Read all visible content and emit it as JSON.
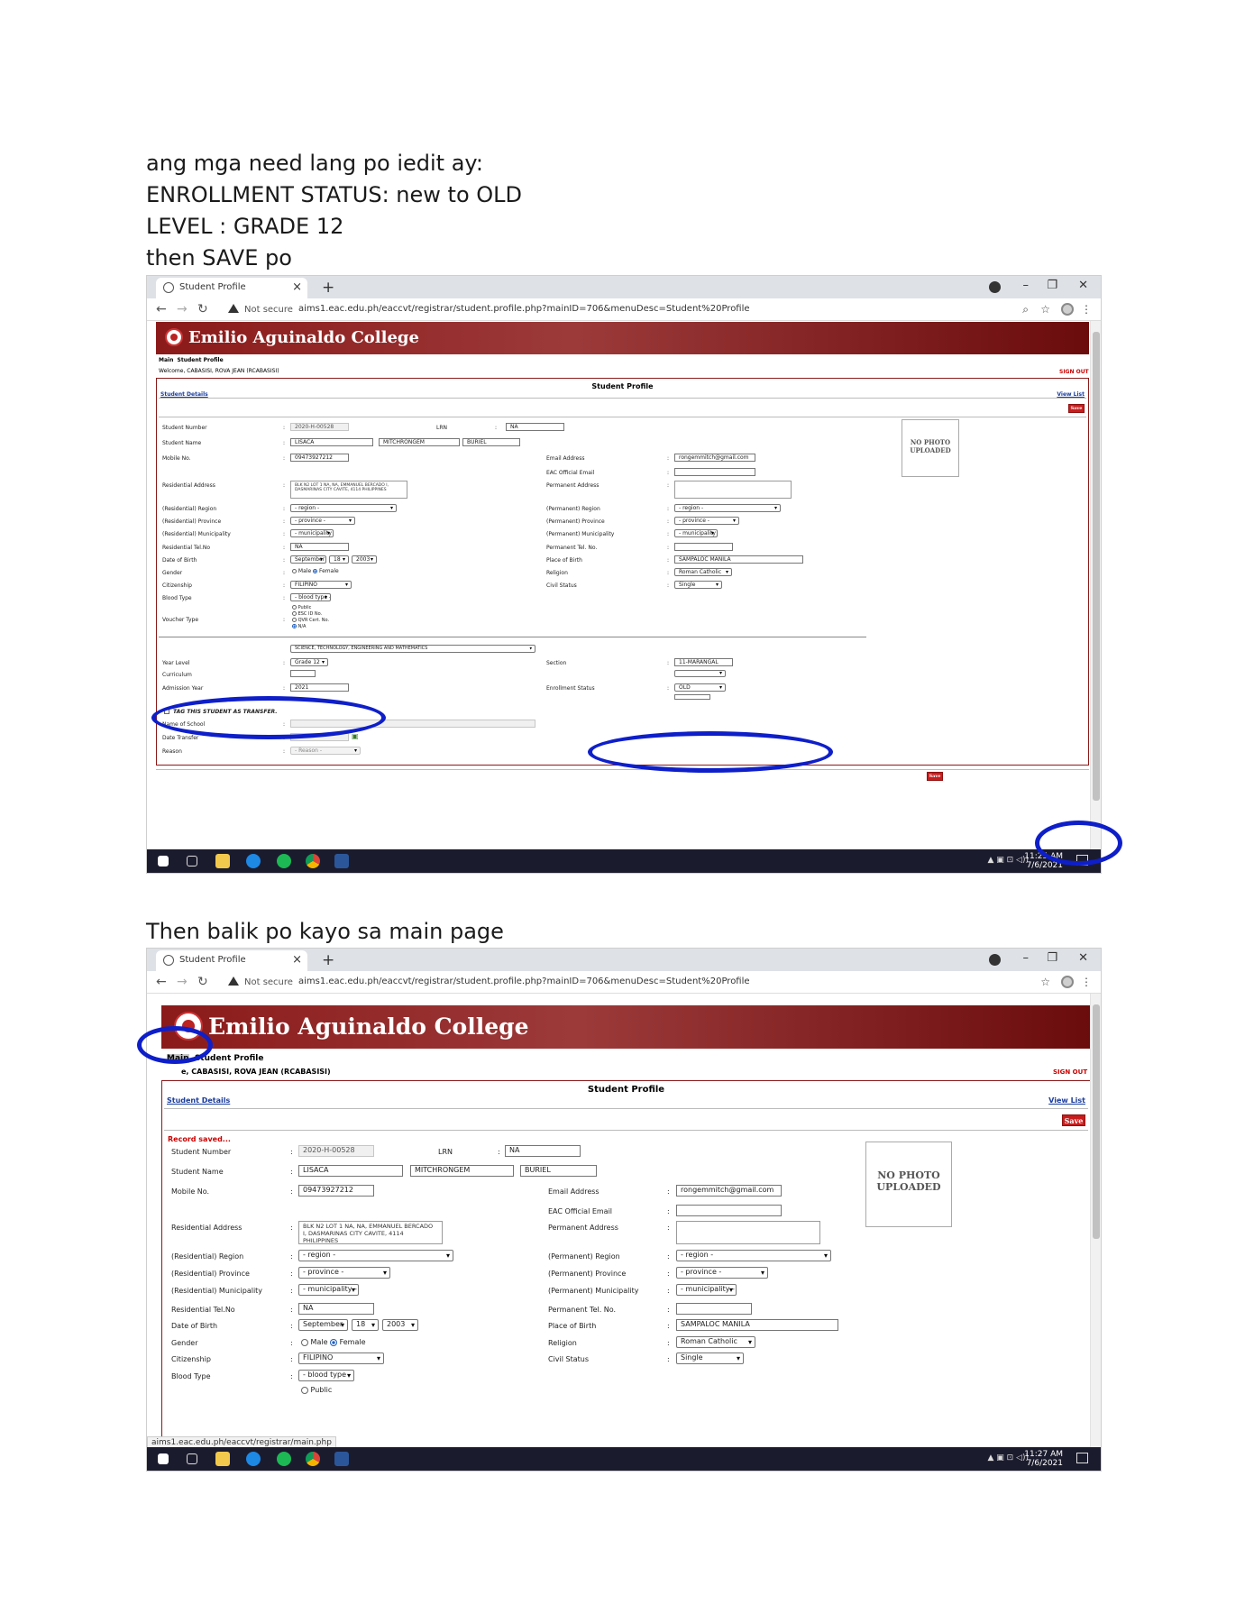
{
  "instructions": {
    "line1": "ang mga need lang po iedit ay:",
    "line2": "ENROLLMENT STATUS: new to OLD",
    "line3": "LEVEL : GRADE 12",
    "line4": "then SAVE po",
    "line5": "Then balik po kayo sa main page"
  },
  "browser": {
    "tab_title": "Student Profile",
    "not_secure": "Not secure",
    "url": "aims1.eac.edu.ph/eaccvt/registrar/student.profile.php?mainID=706&menuDesc=Student%20Profile",
    "status_url": "aims1.eac.edu.ph/eaccvt/registrar/main.php"
  },
  "site": {
    "college_name": "Emilio Aguinaldo College",
    "crumb_main": "Main",
    "crumb_page": "Student Profile",
    "welcome": "Welcome, CABASISI, ROVA JEAN (RCABASISI)",
    "welcome_cut": "e, CABASISI, ROVA JEAN (RCABASISI)",
    "sign_out": "SIGN OUT",
    "form_title": "Student Profile",
    "student_details": "Student Details",
    "view_list": "View List",
    "save": "Save",
    "record_saved": "Record saved...",
    "no_photo_1": "NO PHOTO",
    "no_photo_2": "UPLOADED"
  },
  "labels": {
    "student_number": "Student Number",
    "lrn": "LRN",
    "student_name": "Student Name",
    "mobile": "Mobile No.",
    "email": "Email Address",
    "eac_email": "EAC Official Email",
    "res_address": "Residential Address",
    "perm_address": "Permanent Address",
    "res_region": "(Residential) Region",
    "res_province": "(Residential) Province",
    "res_municipality": "(Residential) Municipality",
    "perm_region": "(Permanent) Region",
    "perm_province": "(Permanent) Province",
    "perm_municipality": "(Permanent) Municipality",
    "res_tel": "Residential Tel.No",
    "perm_tel": "Permanent Tel. No.",
    "dob": "Date of Birth",
    "pob": "Place of Birth",
    "gender": "Gender",
    "religion": "Religion",
    "citizenship": "Citizenship",
    "civil_status": "Civil Status",
    "blood_type": "Blood Type",
    "voucher_type": "Voucher Type",
    "year_level": "Year Level",
    "curriculum": "Curriculum",
    "admission_year": "Admission Year",
    "section": "Section",
    "enrollment_status": "Enrollment Status",
    "tag_transfer": "TAG THIS STUDENT AS TRANSFER.",
    "name_of_school": "Name of School",
    "date_transfer": "Date Transfer",
    "reason": "Reason",
    "male": "Male",
    "female": "Female",
    "v_public": "Public",
    "v_esc": "ESC ID No.",
    "v_qvr": "QVR Cert. No.",
    "v_na": "N/A"
  },
  "values": {
    "student_number": "2020-H-00528",
    "lrn": "NA",
    "last_name": "LISACA",
    "first_name": "MITCHRONGEM",
    "middle_name": "BURIEL",
    "mobile": "09473927212",
    "email": "rongemmitch@gmail.com",
    "res_address": "BLK N2 LOT 1 NA, NA, EMMANUEL BERCADO I, DASMARINAS CITY CAVITE, 4114 PHILIPPINES",
    "region": "- region -",
    "province": "- province -",
    "municipality": "- municipality -",
    "res_tel": "NA",
    "dob_month": "September",
    "dob_day": "18",
    "dob_year": "2003",
    "pob": "SAMPALOC MANILA",
    "religion": "Roman Catholic",
    "citizenship": "FILIPINO",
    "civil_status": "Single",
    "blood_type": "- blood type -",
    "strand": "SCIENCE, TECHNOLOGY, ENGINEERING AND MATHEMATICS",
    "year_level": "Grade 12",
    "admission_year": "2021",
    "section": "11-MARANGAL",
    "enrollment_status": "OLD",
    "reason": "- Reason -"
  },
  "taskbar": {
    "time1": "11:25 AM",
    "date1": "7/6/2021",
    "time2": "11:27 AM",
    "date2": "7/6/2021"
  },
  "colors": {
    "banner": "#8b1a1a",
    "save": "#c81d1d",
    "annotation": "#0e1fc9"
  }
}
